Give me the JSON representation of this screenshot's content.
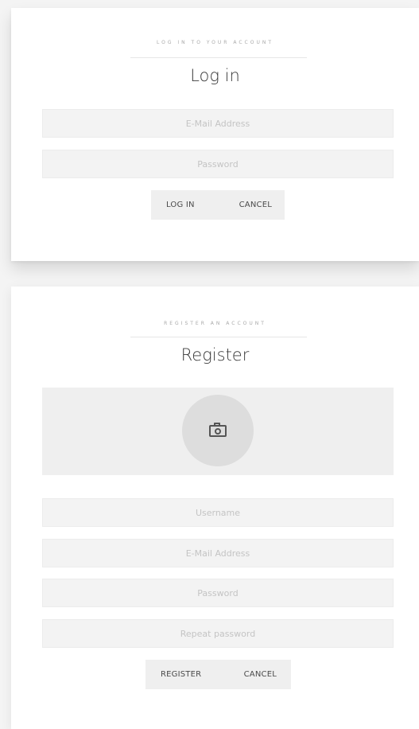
{
  "login": {
    "kicker": "LOG IN TO YOUR ACCOUNT",
    "title": "Log in",
    "email_placeholder": "E-Mail Address",
    "password_placeholder": "Password",
    "login_button": "LOG IN",
    "cancel_button": "CANCEL"
  },
  "register": {
    "kicker": "REGISTER AN ACCOUNT",
    "title": "Register",
    "avatar_icon": "camera-icon",
    "username_placeholder": "Username",
    "email_placeholder": "E-Mail Address",
    "password_placeholder": "Password",
    "repeat_password_placeholder": "Repeat password",
    "register_button": "REGISTER",
    "cancel_button": "CANCEL"
  }
}
